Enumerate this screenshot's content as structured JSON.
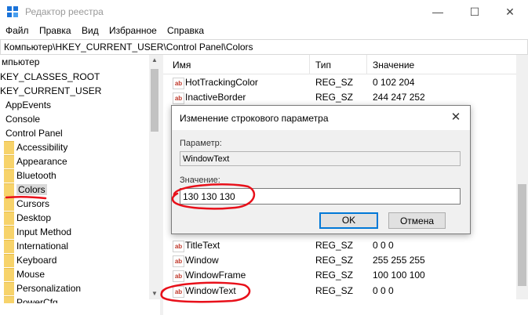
{
  "window": {
    "title": "Редактор реестра",
    "minimize": "—",
    "maximize": "☐",
    "close": "✕"
  },
  "menu": [
    "Файл",
    "Правка",
    "Вид",
    "Избранное",
    "Справка"
  ],
  "address": "Компьютер\\HKEY_CURRENT_USER\\Control Panel\\Colors",
  "tree": {
    "items": [
      {
        "label": "мпьютер",
        "folder": false
      },
      {
        "label": "KEY_CLASSES_ROOT",
        "folder": false
      },
      {
        "label": "KEY_CURRENT_USER",
        "folder": false
      },
      {
        "label": "AppEvents",
        "folder": false
      },
      {
        "label": "Console",
        "folder": false
      },
      {
        "label": "Control Panel",
        "folder": false
      },
      {
        "label": "Accessibility",
        "folder": true
      },
      {
        "label": "Appearance",
        "folder": true
      },
      {
        "label": "Bluetooth",
        "folder": true
      },
      {
        "label": "Colors",
        "folder": true,
        "selected": true
      },
      {
        "label": "Cursors",
        "folder": true
      },
      {
        "label": "Desktop",
        "folder": true
      },
      {
        "label": "Input Method",
        "folder": true
      },
      {
        "label": "International",
        "folder": true
      },
      {
        "label": "Keyboard",
        "folder": true
      },
      {
        "label": "Mouse",
        "folder": true
      },
      {
        "label": "Personalization",
        "folder": true
      },
      {
        "label": "PowerCfg",
        "folder": true
      }
    ]
  },
  "list": {
    "columns": {
      "name": "Имя",
      "type": "Тип",
      "value": "Значение"
    },
    "rows": [
      {
        "name": "HotTrackingColor",
        "type": "REG_SZ",
        "value": "0 102 204"
      },
      {
        "name": "InactiveBorder",
        "type": "REG_SZ",
        "value": "244 247 252"
      },
      {
        "name": "TitleText",
        "type": "REG_SZ",
        "value": "0 0 0"
      },
      {
        "name": "Window",
        "type": "REG_SZ",
        "value": "255 255 255"
      },
      {
        "name": "WindowFrame",
        "type": "REG_SZ",
        "value": "100 100 100"
      },
      {
        "name": "WindowText",
        "type": "REG_SZ",
        "value": "0 0 0"
      }
    ]
  },
  "dialog": {
    "title": "Изменение строкового параметра",
    "param_label": "Параметр:",
    "param_value": "WindowText",
    "value_label": "Значение:",
    "value_text": "130 130 130",
    "ok": "OK",
    "cancel": "Отмена",
    "close": "✕"
  },
  "colors": {
    "annotation": "#e8101a",
    "folder": "#f7d36b",
    "focus": "#0078d7"
  }
}
